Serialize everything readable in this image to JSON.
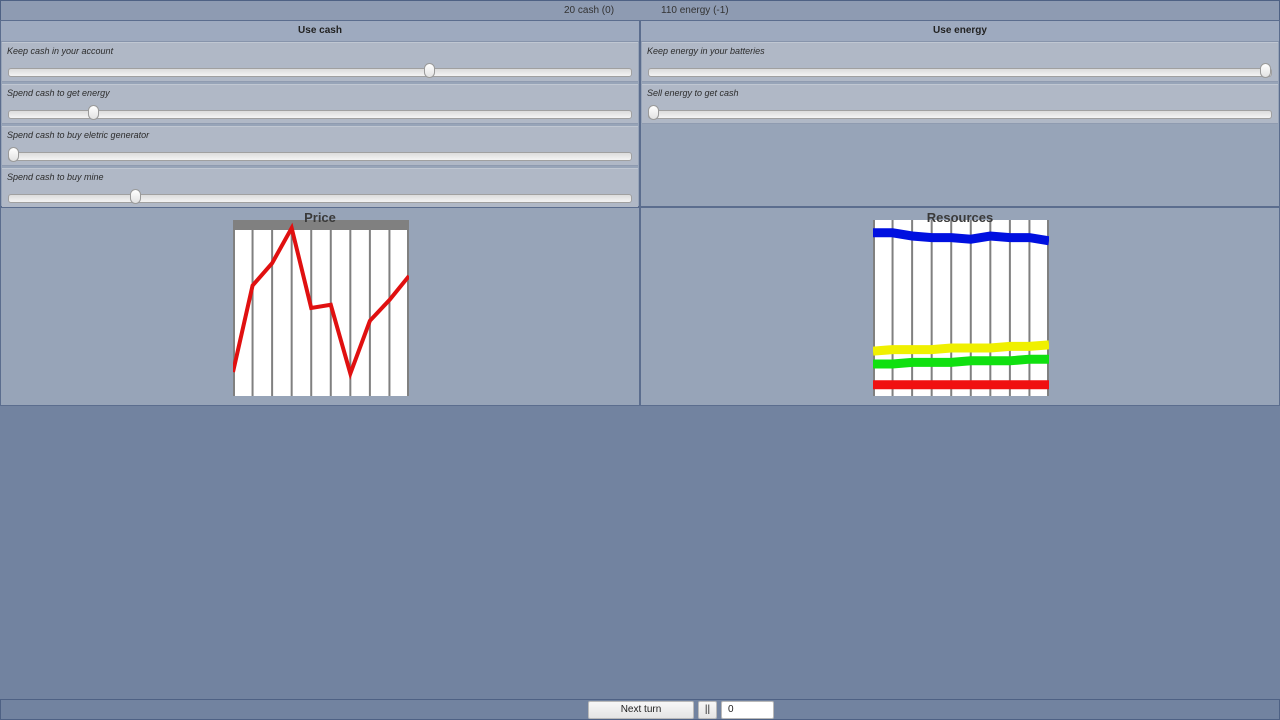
{
  "status": {
    "cash": "20 cash (0)",
    "energy": "110 energy (-1)"
  },
  "cash_panel": {
    "title": "Use cash",
    "sliders": [
      {
        "label": "Keep cash in your account",
        "value": 0.68
      },
      {
        "label": "Spend cash to get energy",
        "value": 0.13
      },
      {
        "label": "Spend cash to buy eletric generator",
        "value": 0.0
      },
      {
        "label": "Spend cash to buy mine",
        "value": 0.2
      }
    ]
  },
  "energy_panel": {
    "title": "Use energy",
    "sliders": [
      {
        "label": "Keep energy in your batteries",
        "value": 1.0
      },
      {
        "label": "Sell energy to get cash",
        "value": 0.0
      }
    ]
  },
  "chart_data": [
    {
      "type": "line",
      "title": "Price",
      "x": [
        0,
        1,
        2,
        3,
        4,
        5,
        6,
        7,
        8,
        9
      ],
      "series": [
        {
          "color": "#e01010",
          "values": [
            0.1,
            0.64,
            0.78,
            1.0,
            0.5,
            0.52,
            0.09,
            0.42,
            0.55,
            0.7
          ]
        }
      ],
      "ylim": [
        0,
        1
      ],
      "grid": true
    },
    {
      "type": "line",
      "title": "Resources",
      "x": [
        0,
        1,
        2,
        3,
        4,
        5,
        6,
        7,
        8,
        9
      ],
      "series": [
        {
          "color": "#0010e0",
          "values": [
            0.97,
            0.97,
            0.95,
            0.94,
            0.94,
            0.93,
            0.95,
            0.94,
            0.94,
            0.92
          ]
        },
        {
          "color": "#f0f000",
          "values": [
            0.23,
            0.24,
            0.24,
            0.24,
            0.25,
            0.25,
            0.25,
            0.26,
            0.26,
            0.27
          ]
        },
        {
          "color": "#10e010",
          "values": [
            0.15,
            0.15,
            0.16,
            0.16,
            0.16,
            0.17,
            0.17,
            0.17,
            0.18,
            0.18
          ]
        },
        {
          "color": "#f01010",
          "values": [
            0.02,
            0.02,
            0.02,
            0.02,
            0.02,
            0.02,
            0.02,
            0.02,
            0.02,
            0.02
          ]
        }
      ],
      "ylim": [
        0,
        1
      ],
      "grid": true
    }
  ],
  "controls": {
    "next_turn_label": "Next turn",
    "pause_label": "||",
    "turn_value": "0"
  }
}
